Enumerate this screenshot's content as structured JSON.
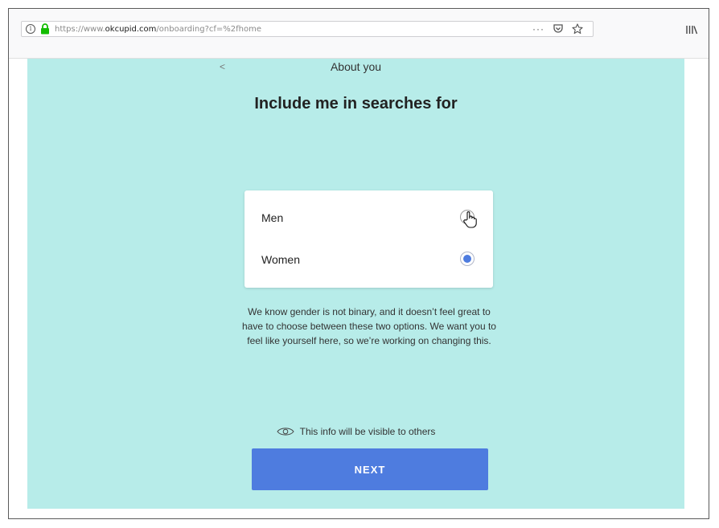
{
  "browser": {
    "url_prefix": "https://www.",
    "url_host": "okcupid.com",
    "url_path": "/onboarding?cf=%2fhome",
    "more_label": "···",
    "icons": {
      "info": "info-icon",
      "lock": "lock-icon",
      "more": "more-icon",
      "pocket": "pocket-icon",
      "bookmark": "star-icon",
      "library": "library-icon"
    },
    "lock_color": "#12bc00"
  },
  "page": {
    "background": "#b7ece9",
    "back_label": "<",
    "section_title": "About you",
    "heading": "Include me in searches for",
    "options": [
      {
        "label": "Men",
        "selected": false
      },
      {
        "label": "Women",
        "selected": true
      }
    ],
    "notice": "We know gender is not binary, and it doesn’t feel great to have to choose between these two options. We want you to feel like yourself here, so we’re working on changing this.",
    "visibility_text": "This info will be visible to others",
    "next_label": "NEXT",
    "accent_color": "#4e7cdf"
  }
}
